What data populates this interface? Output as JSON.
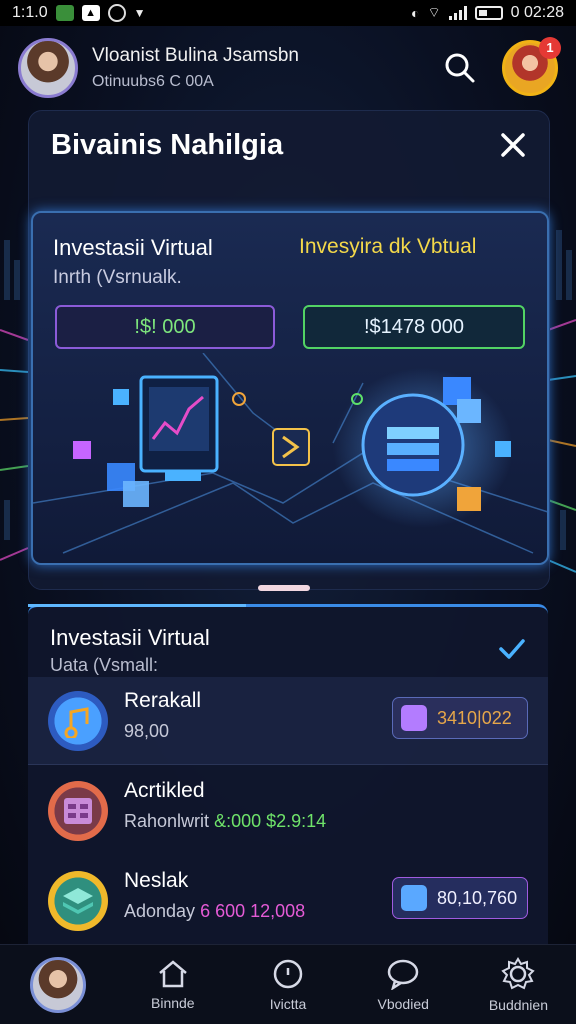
{
  "status_bar": {
    "time_left": "1:1.0",
    "time_right": "0 02:28"
  },
  "header": {
    "user_name": "Vloanist Bulina Jsamsbn",
    "user_sub": "Otinuubs6 C 00A",
    "notification_count": "1"
  },
  "modal": {
    "title": "Bivainis Nahilgia",
    "panel": {
      "title_left": "Investasii Virtual",
      "title_right": "Invesyira dk Vbtual",
      "subtitle": "Inrth (Vsrnualk.",
      "value_left": "!$! 000",
      "value_right": "!$1478 000"
    }
  },
  "list": {
    "title": "Investasii Virtual",
    "subtitle": "Uata (Vsmall:",
    "items": [
      {
        "name": "Rerakall",
        "sub": "98,00",
        "sub_highlight": "",
        "chip_value": "3410|022",
        "icon": "music-note-icon"
      },
      {
        "name": "Acrtikled",
        "sub": "Rahonlwrit",
        "sub_highlight": "&:000 $2.9:14",
        "chip_value": "",
        "icon": "calendar-grid-icon"
      },
      {
        "name": "Neslak",
        "sub": "Adonday",
        "sub_highlight": "6 600 12,008",
        "chip_value": "80,10,760",
        "icon": "layers-icon"
      }
    ]
  },
  "bottom_nav": {
    "items": [
      {
        "label": "Binnde",
        "icon": "home-icon"
      },
      {
        "label": "Ivictta",
        "icon": "target-icon"
      },
      {
        "label": "Vbodied",
        "icon": "chat-icon"
      },
      {
        "label": "Buddnien",
        "icon": "gear-icon"
      }
    ]
  },
  "colors": {
    "accent_blue": "#3a8ce8",
    "accent_yellow": "#f3d84a",
    "accent_green": "#52d364",
    "accent_purple": "#8b5bd8",
    "notif_red": "#e53935"
  }
}
